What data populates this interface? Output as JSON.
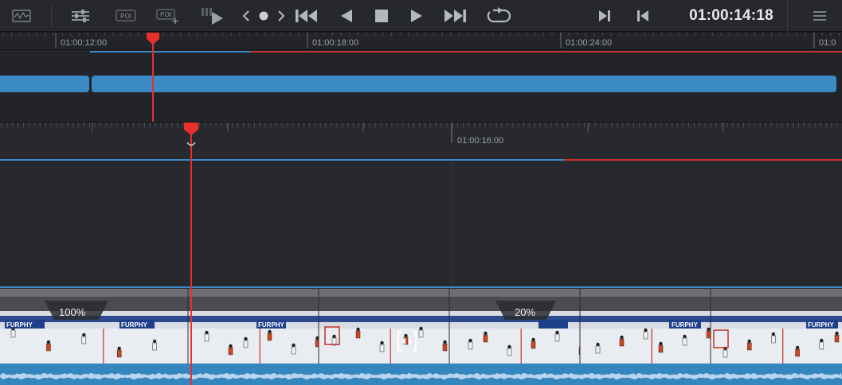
{
  "toolbar": {
    "timecode": "01:00:14:18",
    "icons": [
      "waveform-icon",
      "mixer-icon",
      "poi-marker-icon",
      "add-poi-icon",
      "play-to-icon",
      "prev-marker-icon",
      "marker-dot-icon",
      "next-marker-icon",
      "skip-to-start-icon",
      "play-reverse-icon",
      "stop-icon",
      "play-icon",
      "skip-to-end-icon",
      "loop-icon",
      "mark-in-icon",
      "mark-out-icon",
      "options-menu-icon"
    ],
    "poi_label": "POI"
  },
  "upper_timeline": {
    "ruler_labels": [
      "01:00:12:00",
      "01:00:18:00",
      "01:00:24:00",
      "01:0"
    ]
  },
  "lower_timeline": {
    "ruler_labels": [
      "01:00:16:00"
    ]
  },
  "retime": {
    "segments": [
      {
        "speed_label": "100%"
      },
      {
        "speed_label": "20%"
      }
    ],
    "handle_icon": "retime-handle-icon"
  },
  "board_text": [
    "FURPHY",
    "FURPHY",
    "FURPHY",
    "FURPHY",
    "FURPHY"
  ],
  "colors": {
    "accent_blue": "#3b8ac6",
    "playhead_red": "#e8302a",
    "speed_marker_yellow": "#e8d84a"
  }
}
